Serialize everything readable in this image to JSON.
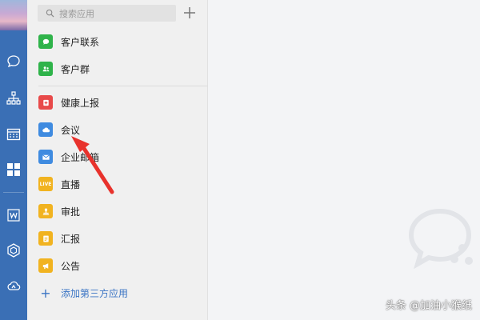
{
  "search": {
    "placeholder": "搜索应用"
  },
  "rail": {
    "icons": [
      "chat-icon",
      "org-chart-icon",
      "calendar-icon",
      "apps-grid-icon",
      "doc-w-icon",
      "hexagon-icon",
      "cloud-icon"
    ]
  },
  "sidebar": {
    "items": [
      {
        "label": "客户联系",
        "icon": "chat-bubble-icon",
        "color": "#2fb34a"
      },
      {
        "label": "客户群",
        "icon": "people-icon",
        "color": "#2fb34a"
      },
      {
        "label": "健康上报",
        "icon": "health-report-icon",
        "color": "#e84a4a"
      },
      {
        "label": "会议",
        "icon": "cloud-meeting-icon",
        "color": "#3f8be0"
      },
      {
        "label": "企业邮箱",
        "icon": "mail-icon",
        "color": "#3f8be0"
      },
      {
        "label": "直播",
        "icon": "live-icon",
        "color": "#f1b320",
        "badge": "LIVE"
      },
      {
        "label": "审批",
        "icon": "stamp-icon",
        "color": "#f1b320"
      },
      {
        "label": "汇报",
        "icon": "report-icon",
        "color": "#f1b320"
      },
      {
        "label": "公告",
        "icon": "megaphone-icon",
        "color": "#f1b320"
      }
    ],
    "add_label": "添加第三方应用"
  },
  "credit": "头条 @加油小猴纸",
  "colors": {
    "rail": "#3a6fb5",
    "accent": "#3a74c4",
    "arrow": "#e8322c"
  }
}
